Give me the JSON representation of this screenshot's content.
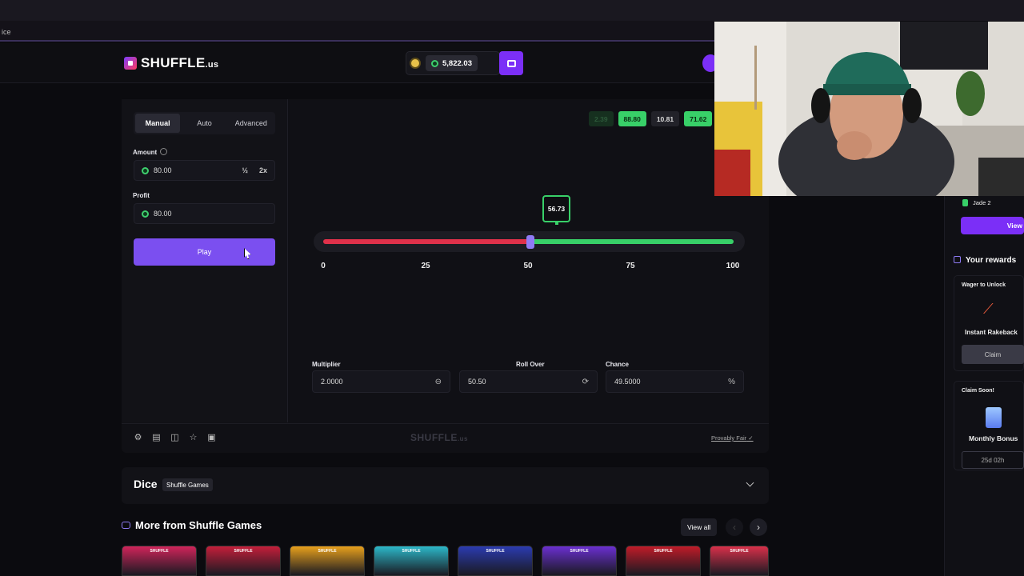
{
  "browser": {
    "address_fragment": "ice"
  },
  "header": {
    "logo": "SHUFFLE",
    "logo_suffix": ".us",
    "balance": "5,822.03"
  },
  "controls": {
    "tabs": [
      "Manual",
      "Auto",
      "Advanced"
    ],
    "active_tab": "Manual",
    "amount_label": "Amount",
    "amount_value": "80.00",
    "half_label": "½",
    "double_label": "2x",
    "profit_label": "Profit",
    "profit_value": "80.00",
    "play_label": "Play"
  },
  "game": {
    "history": [
      {
        "value": "2.39",
        "style": "fade"
      },
      {
        "value": "88.80",
        "style": "g"
      },
      {
        "value": "10.81",
        "style": "d"
      },
      {
        "value": "71.62",
        "style": "g"
      }
    ],
    "result": "56.73",
    "result_fraction": 0.5673,
    "slider_fraction": 0.505,
    "ticks": [
      "0",
      "25",
      "50",
      "75",
      "100"
    ],
    "multiplier_label": "Multiplier",
    "multiplier_value": "2.0000",
    "rollover_label": "Roll Over",
    "rollover_value": "50.50",
    "chance_label": "Chance",
    "chance_value": "49.5000",
    "chance_suffix": "%",
    "watermark": "SHUFFLE",
    "watermark_suffix": ".us",
    "provably_fair": "Provably Fair"
  },
  "info": {
    "title": "Dice",
    "badge": "Shuffle Games"
  },
  "more": {
    "title": "More from Shuffle Games",
    "view_all": "View all",
    "thumb_brand": "SHUFFLE",
    "thumb_colors": [
      "#d0245a",
      "#c41e3a",
      "#e8a01c",
      "#2cb8c9",
      "#2b3bb0",
      "#6a2fd0",
      "#c01b28",
      "#d9304a"
    ]
  },
  "sidebar": {
    "vip_name": "Jade 2",
    "view_label": "View",
    "rewards_title": "Your rewards",
    "wager_label": "Wager to Unlock",
    "rakeback_title": "Instant Rakeback",
    "claim_label": "Claim",
    "claim_soon": "Claim Soon!",
    "monthly_title": "Monthly Bonus",
    "countdown": "25d 02h"
  }
}
